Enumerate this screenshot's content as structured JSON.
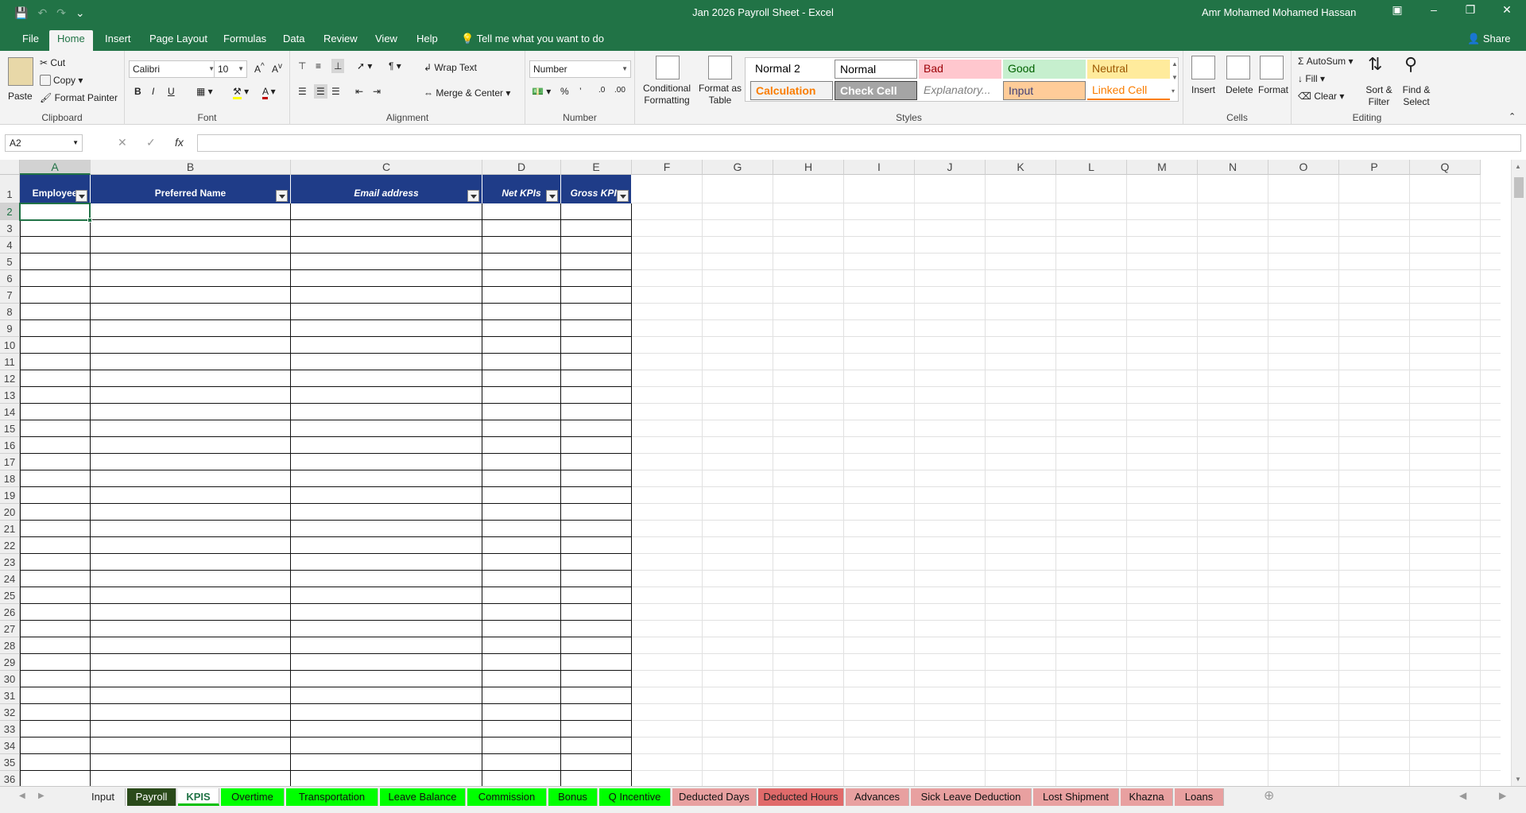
{
  "window": {
    "title": "Jan 2026 Payroll Sheet  -  Excel",
    "user": "Amr Mohamed Mohamed Hassan",
    "share": "Share"
  },
  "menu": {
    "tabs": [
      "File",
      "Home",
      "Insert",
      "Page Layout",
      "Formulas",
      "Data",
      "Review",
      "View",
      "Help"
    ],
    "active": "Home",
    "tell_me": "Tell me what you want to do"
  },
  "ribbon": {
    "clipboard": {
      "paste": "Paste",
      "cut": "Cut",
      "copy": "Copy",
      "format_painter": "Format Painter",
      "label": "Clipboard"
    },
    "font": {
      "name": "Calibri",
      "size": "10",
      "bold": "B",
      "italic": "I",
      "underline": "U",
      "label": "Font"
    },
    "alignment": {
      "wrap": "Wrap Text",
      "merge": "Merge & Center",
      "label": "Alignment"
    },
    "number": {
      "format": "Number",
      "percent": "%",
      "comma": "’",
      "label": "Number"
    },
    "styles": {
      "conditional": "Conditional Formatting",
      "format_table": "Format as Table",
      "cells": [
        {
          "text": "Normal 2",
          "bg": "#ffffff",
          "fg": "#000000",
          "border": "none"
        },
        {
          "text": "Normal",
          "bg": "#ffffff",
          "fg": "#000000",
          "border": "#8a8a8a"
        },
        {
          "text": "Bad",
          "bg": "#ffc7ce",
          "fg": "#9c0006",
          "border": "none"
        },
        {
          "text": "Good",
          "bg": "#c6efce",
          "fg": "#006100",
          "border": "none"
        },
        {
          "text": "Neutral",
          "bg": "#ffeb9c",
          "fg": "#9c5700",
          "border": "none"
        },
        {
          "text": "Calculation",
          "bg": "#f2f2f2",
          "fg": "#fa7d00",
          "border": "#7f7f7f"
        },
        {
          "text": "Check Cell",
          "bg": "#a5a5a5",
          "fg": "#ffffff",
          "border": "#3f3f3f"
        },
        {
          "text": "Explanatory...",
          "bg": "#ffffff",
          "fg": "#7f7f7f",
          "border": "none"
        },
        {
          "text": "Input",
          "bg": "#ffcc99",
          "fg": "#3f3f76",
          "border": "#7f7f7f"
        },
        {
          "text": "Linked Cell",
          "bg": "#ffffff",
          "fg": "#fa7d00",
          "border": "none"
        }
      ],
      "label": "Styles"
    },
    "cells": {
      "insert": "Insert",
      "delete": "Delete",
      "format": "Format",
      "label": "Cells"
    },
    "editing": {
      "autosum": "AutoSum",
      "fill": "Fill",
      "clear": "Clear",
      "sort": "Sort & Filter",
      "find": "Find & Select",
      "label": "Editing"
    }
  },
  "formula_bar": {
    "name_box": "A2",
    "fx": "fx",
    "value": ""
  },
  "sheet": {
    "columns": [
      "A",
      "B",
      "C",
      "D",
      "E",
      "F",
      "G",
      "H",
      "I",
      "J",
      "K",
      "L",
      "M",
      "N",
      "O",
      "P",
      "Q"
    ],
    "selected_col": "A",
    "selected_row": 2,
    "rows": [
      "1",
      "2",
      "3",
      "4",
      "5",
      "6",
      "7",
      "8",
      "9",
      "10",
      "11",
      "12",
      "13",
      "14",
      "15",
      "16",
      "17",
      "18",
      "19",
      "20",
      "21",
      "22",
      "23",
      "24",
      "25",
      "26",
      "27",
      "28",
      "29",
      "30",
      "31",
      "32",
      "33",
      "34",
      "35",
      "36"
    ],
    "headers": [
      "Employee",
      "Preferred Name",
      "Email address",
      "Net KPIs",
      "Gross KPIs"
    ]
  },
  "sheet_tabs": [
    {
      "name": "Input",
      "style": "plain"
    },
    {
      "name": "Payroll",
      "style": "payroll"
    },
    {
      "name": "KPIS",
      "style": "kpis"
    },
    {
      "name": "Overtime",
      "style": "green"
    },
    {
      "name": "Transportation",
      "style": "green"
    },
    {
      "name": "Leave Balance",
      "style": "green"
    },
    {
      "name": "Commission",
      "style": "green"
    },
    {
      "name": "Bonus",
      "style": "green"
    },
    {
      "name": "Q Incentive",
      "style": "green"
    },
    {
      "name": "Deducted Days",
      "style": "red"
    },
    {
      "name": "Deducted Hours",
      "style": "dred"
    },
    {
      "name": "Advances",
      "style": "red"
    },
    {
      "name": "Sick Leave Deduction",
      "style": "red"
    },
    {
      "name": "Lost Shipment",
      "style": "red"
    },
    {
      "name": "Khazna",
      "style": "red"
    },
    {
      "name": "Loans",
      "style": "red"
    }
  ]
}
